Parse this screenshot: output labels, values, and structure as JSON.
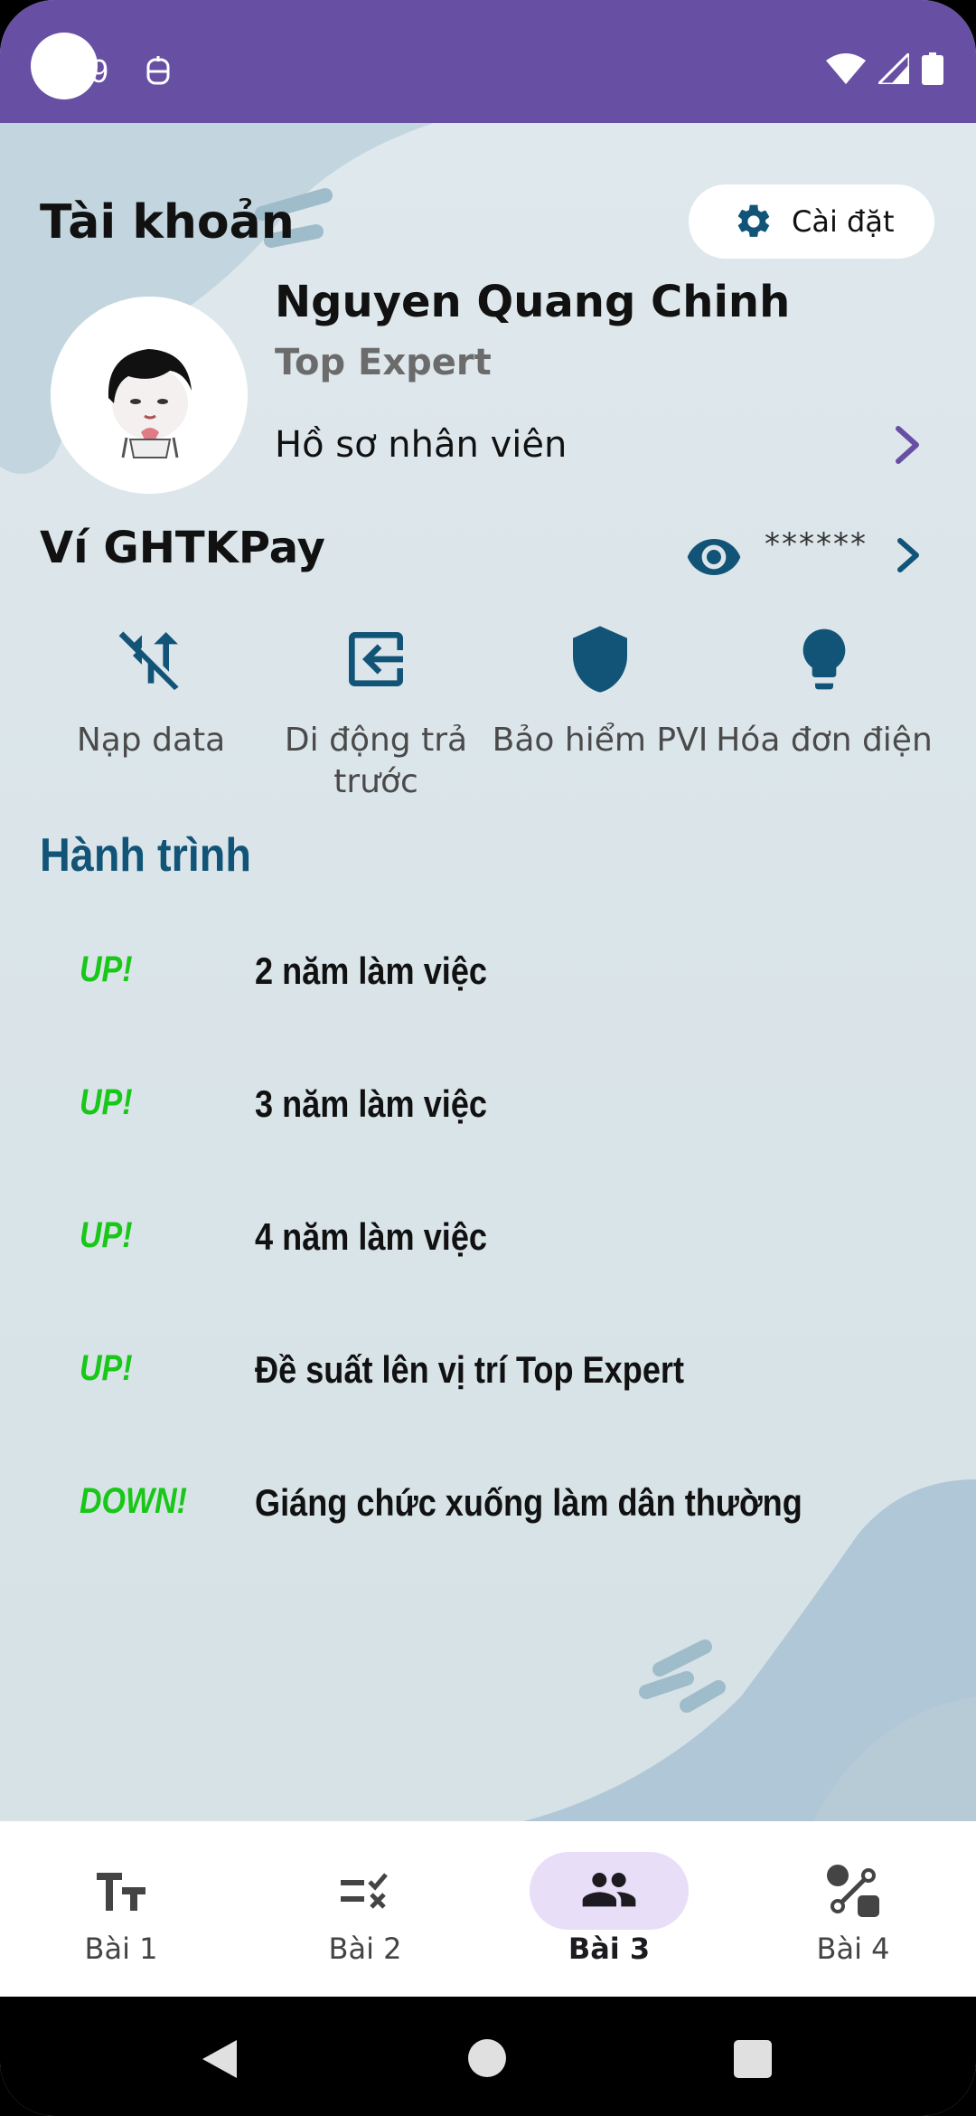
{
  "status_bar": {
    "time": "9",
    "background": "#6750a4"
  },
  "header": {
    "title": "Tài khoản",
    "settings_label": "Cài đặt"
  },
  "profile": {
    "name": "Nguyen Quang Chinh",
    "rank": "Top Expert",
    "link_label": "Hồ sơ nhân viên"
  },
  "wallet": {
    "title": "Ví GHTKPay",
    "balance_masked": "******"
  },
  "services": [
    {
      "label": "Nạp data",
      "icon": "data-transfer-off-icon"
    },
    {
      "label": "Di động trả trước",
      "icon": "exit-to-app-icon"
    },
    {
      "label": "Bảo hiểm PVI",
      "icon": "shield-icon"
    },
    {
      "label": "Hóa đơn điện",
      "icon": "lightbulb-icon"
    }
  ],
  "journey": {
    "title": "Hành trình",
    "items": [
      {
        "badge": "UP!",
        "text": "2 năm làm việc"
      },
      {
        "badge": "UP!",
        "text": "3 năm làm việc"
      },
      {
        "badge": "UP!",
        "text": "4 năm làm việc"
      },
      {
        "badge": "UP!",
        "text": "Đề suất lên vị trí Top Expert"
      },
      {
        "badge": "DOWN!",
        "text": "Giáng chức xuống làm dân thường"
      }
    ]
  },
  "bottom_nav": [
    {
      "label": "Bài 1",
      "icon": "text-size-icon",
      "active": false
    },
    {
      "label": "Bài 2",
      "icon": "checklist-icon",
      "active": false
    },
    {
      "label": "Bài 3",
      "icon": "people-icon",
      "active": true
    },
    {
      "label": "Bài 4",
      "icon": "shapes-icon",
      "active": false
    }
  ],
  "colors": {
    "accent": "#6750a4",
    "icon_blue": "#125478",
    "badge_green": "#18c718",
    "nav_active_pill": "#e8def8"
  }
}
